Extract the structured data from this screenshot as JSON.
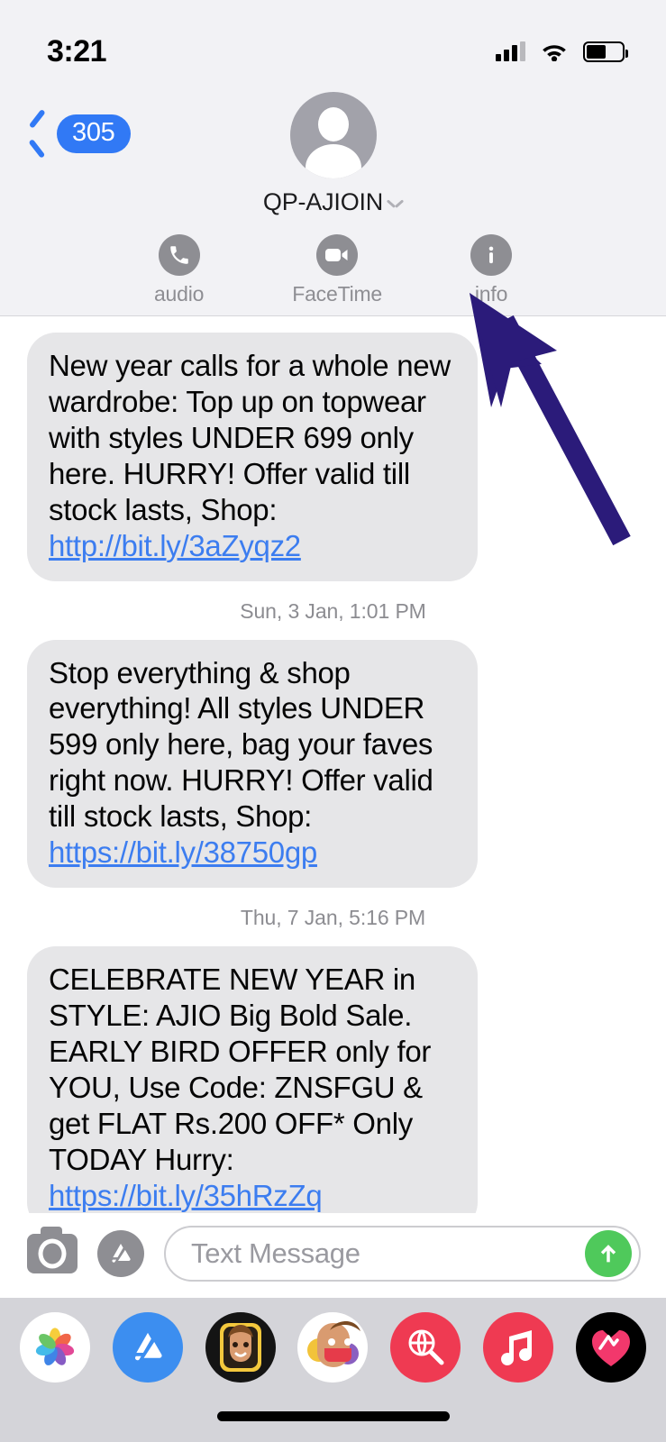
{
  "status_bar": {
    "time": "3:21",
    "signal_icon": "cellular-signal-icon",
    "wifi_icon": "wifi-icon",
    "battery_icon": "battery-icon",
    "battery_level_percent": 55
  },
  "nav": {
    "back_label": "305",
    "back_icon": "chevron-left-icon",
    "contact_name": "QP-AJIOIN",
    "contact_chevron_icon": "chevron-down-icon",
    "avatar_icon": "person-placeholder-avatar",
    "actions": [
      {
        "label": "audio",
        "icon": "phone-icon"
      },
      {
        "label": "FaceTime",
        "icon": "video-camera-icon"
      },
      {
        "label": "info",
        "icon": "info-circle-icon"
      }
    ]
  },
  "thread": {
    "messages": [
      {
        "id": "msg-1",
        "text_before_link": "New year calls for a whole new wardrobe: Top up on topwear with styles UNDER 699 only here. HURRY! Offer valid till stock lasts, Shop: ",
        "link": "http://bit.ly/3aZyqz2"
      },
      {
        "id": "msg-2",
        "timestamp": "Sun, 3 Jan, 1:01 PM",
        "text_before_link": "Stop everything & shop everything! All styles UNDER 599 only here, bag your faves right now. HURRY! Offer valid till stock lasts, Shop: ",
        "link": "https://bit.ly/38750gp"
      },
      {
        "id": "msg-3",
        "timestamp": "Thu, 7 Jan, 5:16 PM",
        "text_before_link": "CELEBRATE NEW YEAR in STYLE: AJIO Big Bold Sale. EARLY BIRD OFFER only for YOU, Use Code: ZNSFGU & get FLAT Rs.200 OFF* Only TODAY Hurry: ",
        "link": "https://bit.ly/35hRzZq"
      }
    ]
  },
  "composer": {
    "camera_icon": "camera-icon",
    "appstore_icon": "app-store-icon",
    "placeholder": "Text Message",
    "input_value": "",
    "send_icon": "send-arrow-up-icon",
    "send_color": "#4fc95b"
  },
  "app_drawer": {
    "apps": [
      {
        "name": "photos-app-icon"
      },
      {
        "name": "app-store-app-icon"
      },
      {
        "name": "memoji-app-icon"
      },
      {
        "name": "animoji-stickers-app-icon"
      },
      {
        "name": "images-search-app-icon"
      },
      {
        "name": "apple-music-app-icon"
      },
      {
        "name": "fitness-activity-app-icon"
      }
    ]
  },
  "annotation": {
    "arrow_icon": "pointer-arrow-annotation",
    "arrow_color": "#2b1b7a",
    "points_to": "info"
  },
  "home_indicator": {
    "icon": "home-indicator-bar"
  },
  "colors": {
    "bubble_bg": "#e6e6e8",
    "link": "#3c7df0",
    "ios_blue": "#3179f5",
    "gray_icon": "#8e8e93",
    "drawer_bg": "#d4d4d9"
  }
}
